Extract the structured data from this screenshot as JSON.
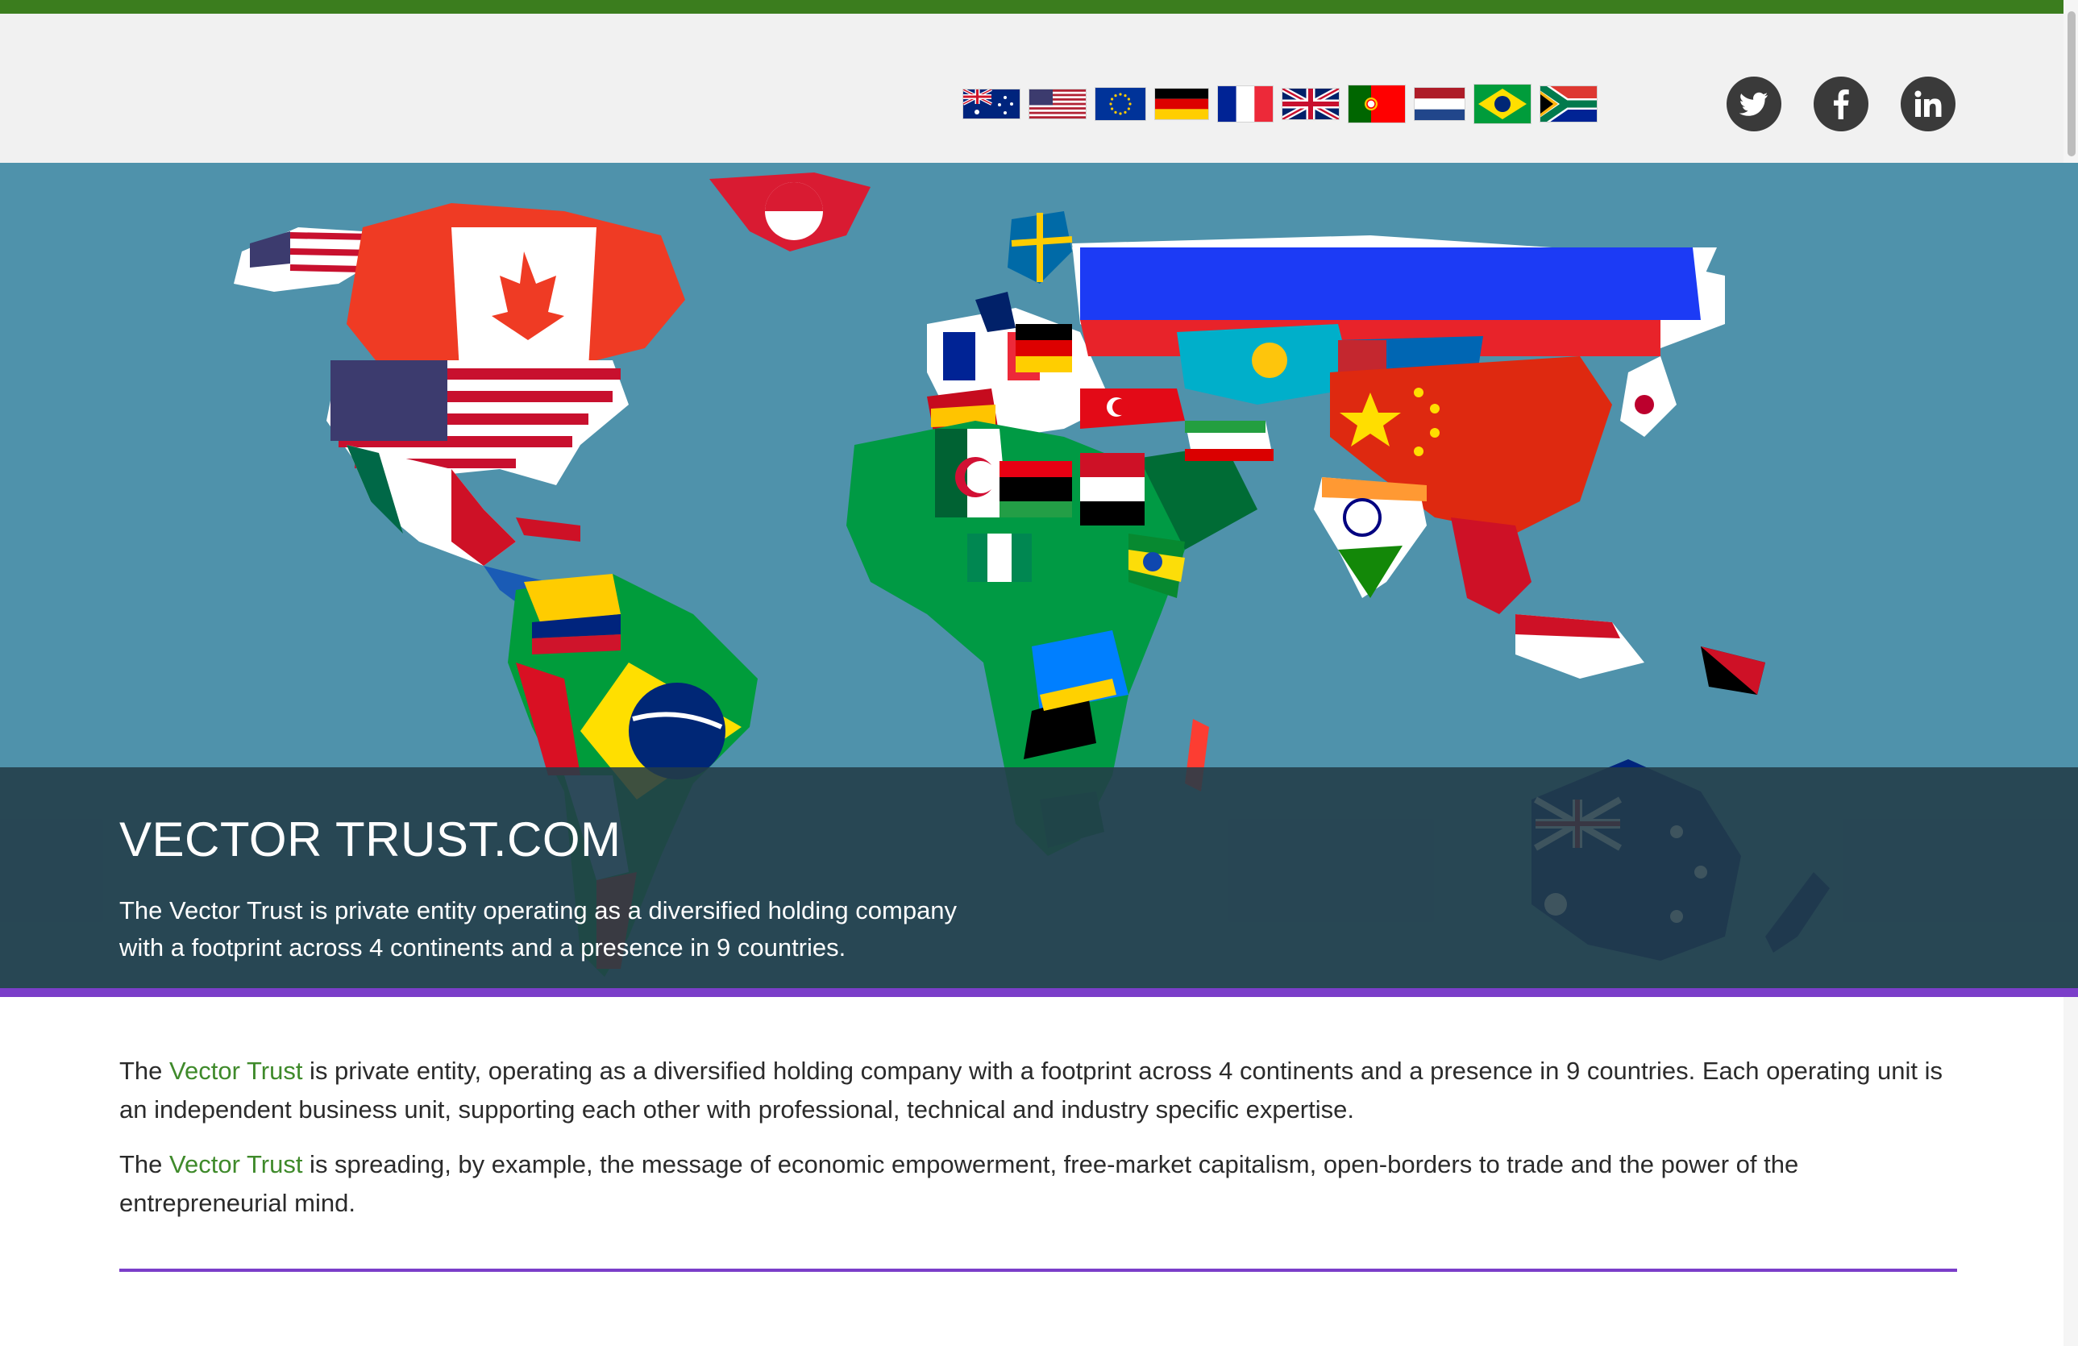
{
  "header": {
    "flags": [
      {
        "name": "australia-flag-icon"
      },
      {
        "name": "usa-flag-icon"
      },
      {
        "name": "eu-flag-icon"
      },
      {
        "name": "germany-flag-icon"
      },
      {
        "name": "france-flag-icon"
      },
      {
        "name": "uk-flag-icon"
      },
      {
        "name": "portugal-flag-icon"
      },
      {
        "name": "netherlands-flag-icon"
      },
      {
        "name": "brazil-flag-icon"
      },
      {
        "name": "south-africa-flag-icon"
      }
    ],
    "socials": [
      "twitter-icon",
      "facebook-icon",
      "linkedin-icon"
    ],
    "colors": {
      "top_strip": "#3b7d1e",
      "header_bg": "#f1f1f1",
      "social_bg": "#3a3a3a"
    }
  },
  "hero": {
    "title": "VECTOR TRUST.COM",
    "line1": "The Vector Trust is private entity operating as a diversified holding company",
    "line2": "with a footprint across 4 continents and a presence in 9 countries.",
    "map_bg": "#4f92ab",
    "accent": "#7b3ec9"
  },
  "content": {
    "p1_pre": "The ",
    "p1_brand": "Vector Trust",
    "p1_post": " is private entity, operating as a diversified holding company with a footprint across 4 continents and a presence in 9 countries. Each operating unit is an independent business unit, supporting each other with professional, technical and industry specific expertise.",
    "p2_pre": "The ",
    "p2_brand": "Vector Trust",
    "p2_post": " is spreading, by example, the message of economic empowerment, free-market capitalism, open-borders to trade and the power of the entrepreneurial mind.",
    "brand_color": "#3f8a2b"
  }
}
